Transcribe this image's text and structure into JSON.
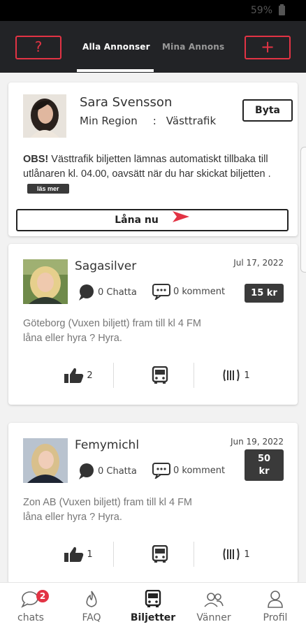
{
  "status_bar": {
    "battery": "59%"
  },
  "header": {
    "help_label": "?",
    "add_label": "+",
    "tabs": [
      {
        "label": "Alla Annonser",
        "active": true
      },
      {
        "label": "Mina Annons",
        "active": false
      }
    ]
  },
  "profile": {
    "name": "Sara Svensson",
    "region_label": "Min Region",
    "region_sep": ":",
    "region_value": "Västtrafik",
    "switch_label": "Byta",
    "notice_bold": "OBS!",
    "notice_text": " Västtrafik biljetten lämnas automatiskt tillbaka till utlånaren kl. 04.00, oavsätt när du har skickat biljetten .",
    "read_more": "läs mer",
    "borrow_label": "Låna nu"
  },
  "ads": [
    {
      "user": "Sagasilver",
      "date": "Jul 17, 2022",
      "chat_count": "0 Chatta",
      "comment_count": "0 komment",
      "price": "15 kr",
      "desc_line1": "Göteborg (Vuxen biljett) fram till kl 4 FM",
      "desc_line2": "låna eller hyra ? Hyra.",
      "likes": "2",
      "cards": "1"
    },
    {
      "user": "Femymichl",
      "date": "Jun 19, 2022",
      "chat_count": "0 Chatta",
      "comment_count": "0 komment",
      "price": "50\nkr",
      "desc_line1": "Zon AB (Vuxen biljett) fram till kl 4 FM",
      "desc_line2": "låna eller hyra ? Hyra.",
      "likes": "1",
      "cards": "1"
    }
  ],
  "bottom_nav": [
    {
      "label": "chats",
      "badge": "2",
      "icon": "chat-icon"
    },
    {
      "label": "FAQ",
      "icon": "flame-icon"
    },
    {
      "label": "Biljetter",
      "icon": "bus-icon",
      "active": true
    },
    {
      "label": "Vänner",
      "icon": "friends-icon"
    },
    {
      "label": "Profil",
      "icon": "profile-icon"
    }
  ],
  "colors": {
    "accent": "#e23344",
    "header_bg": "#222326",
    "price_bg": "#3a3a3a"
  }
}
